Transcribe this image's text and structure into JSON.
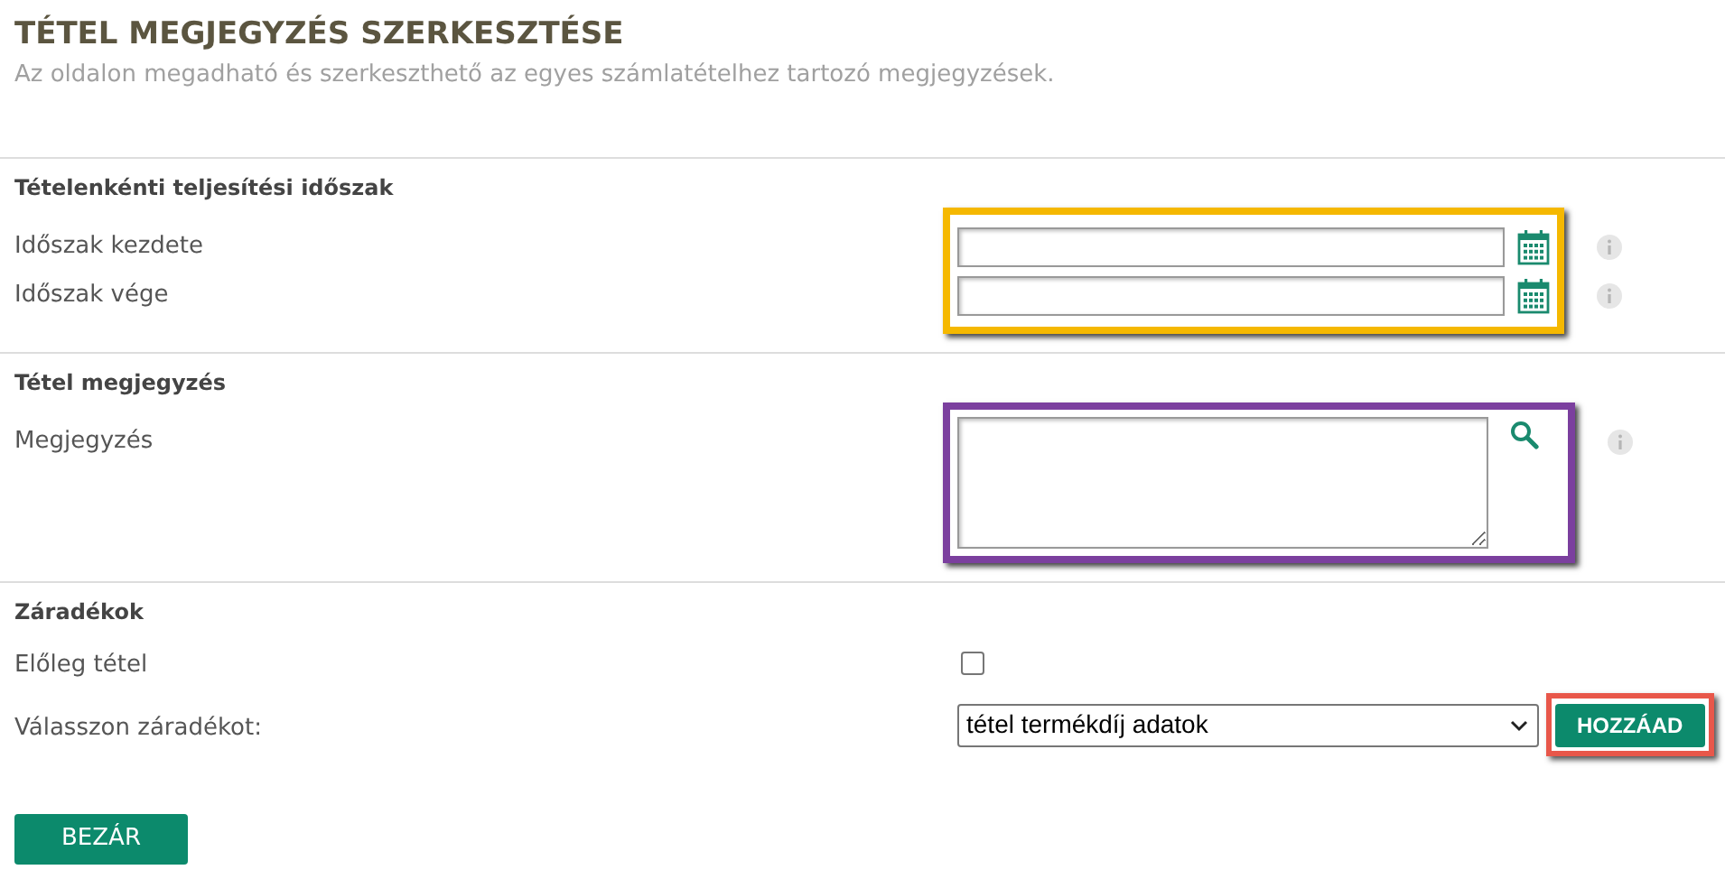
{
  "page": {
    "title": "TÉTEL MEGJEGYZÉS SZERKESZTÉSE",
    "subtitle": "Az oldalon megadható és szerkeszthető az egyes számlatételhez tartozó megjegyzések."
  },
  "sections": [
    {
      "title": "Tételenkénti teljesítési időszak",
      "color": "#f5b800",
      "rows": [
        {
          "kind": "date",
          "label": "Időszak kezdete",
          "info": true
        },
        {
          "kind": "date",
          "label": "Időszak vége",
          "info": true
        }
      ]
    },
    {
      "title": "Tétel megjegyzés",
      "color": "#7b3f9e",
      "rows": [
        {
          "kind": "textarea",
          "label": "Megjegyzés",
          "info": true
        }
      ]
    },
    {
      "title": "Záradékok",
      "rows": [
        {
          "kind": "checkbox",
          "label": "Előleg tétel",
          "checked": false
        },
        {
          "kind": "select",
          "label": "Válasszon záradékot:",
          "value": "tétel termékdíj adatok",
          "button": {
            "label": "HOZZÁAD",
            "color": "#e8574a"
          }
        }
      ]
    }
  ],
  "close_button": "BEZÁR"
}
